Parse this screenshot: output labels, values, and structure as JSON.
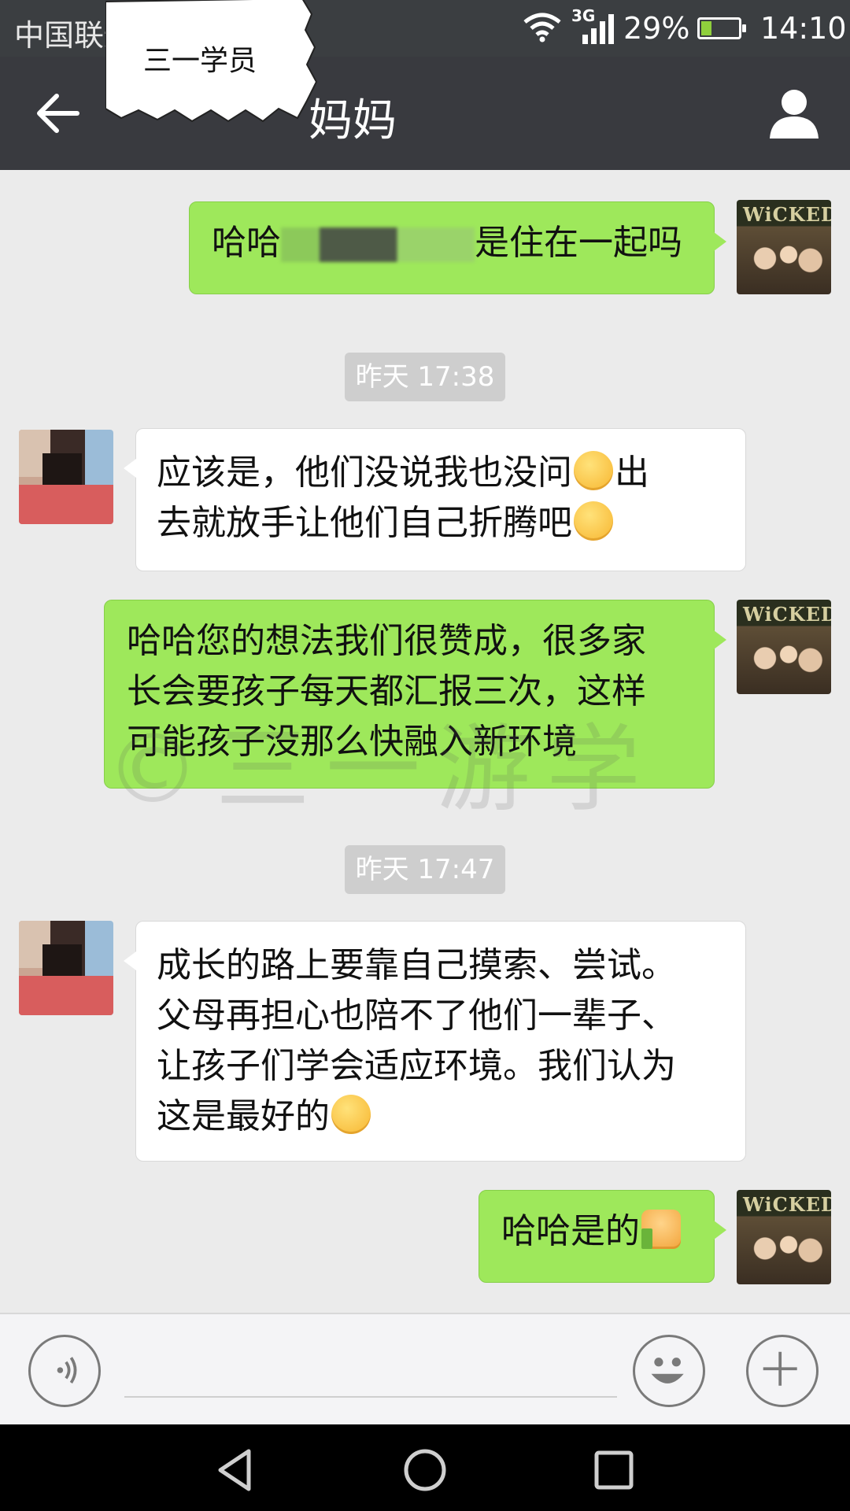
{
  "status_bar": {
    "carrier": "中国联通",
    "network": "3G",
    "battery": "29%",
    "time": "14:10",
    "battery_level": 0.29
  },
  "header": {
    "title": "妈妈",
    "sticker_label": "三一学员"
  },
  "messages": [
    {
      "sender": "me",
      "parts": [
        "哈哈",
        "是住在一起吗"
      ]
    },
    {
      "type": "timestamp",
      "text": "昨天 17:38"
    },
    {
      "sender": "them",
      "lines": [
        "应该是，他们没说我也没问",
        "出",
        "去就放手让他们自己折腾吧"
      ]
    },
    {
      "sender": "me",
      "lines": [
        "哈哈您的想法我们很赞成，很多家",
        "长会要孩子每天都汇报三次，这样",
        "可能孩子没那么快融入新环境"
      ]
    },
    {
      "type": "timestamp",
      "text": "昨天 17:47"
    },
    {
      "sender": "them",
      "lines": [
        "成长的路上要靠自己摸索、尝试。",
        "父母再担心也陪不了他们一辈子、",
        "让孩子们学会适应环境。我们认为",
        "这是最好的"
      ]
    },
    {
      "sender": "me",
      "text": "哈哈是的"
    }
  ],
  "avatar_caption": "WiCKED",
  "watermark": "©三一游学",
  "input_bar": {
    "placeholder": ""
  },
  "icons": {
    "back": "arrow-left-icon",
    "profile": "person-icon",
    "voice": "voice-icon",
    "emoji": "smiley-icon",
    "more": "plus-icon",
    "nav_back": "triangle-back-icon",
    "nav_home": "circle-home-icon",
    "nav_recent": "square-recent-icon"
  },
  "colors": {
    "my_bubble": "#9ee85b",
    "their_bubble": "#ffffff",
    "header": "#393a3f",
    "background": "#ebebeb"
  }
}
